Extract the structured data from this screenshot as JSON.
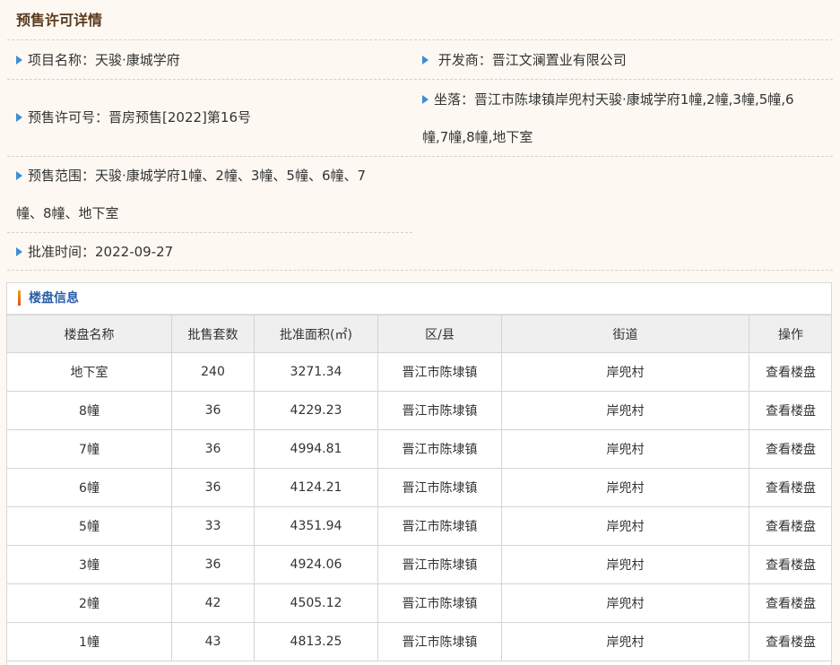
{
  "title": "预售许可详情",
  "info": {
    "project_name": {
      "label": "项目名称：",
      "value": "天骏·康城学府"
    },
    "developer": {
      "label": "开发商：",
      "value": "晋江文澜置业有限公司"
    },
    "permit_no": {
      "label": "预售许可号：",
      "value": "晋房预售[2022]第16号"
    },
    "location": {
      "label": "坐落：",
      "value_line1": "晋江市陈埭镇岸兜村天骏·康城学府1幢,2幢,3幢,5幢,6",
      "value_line2": "幢,7幢,8幢,地下室"
    },
    "scope": {
      "label": "预售范围：",
      "value_line1": "天骏·康城学府1幢、2幢、3幢、5幢、6幢、7",
      "value_line2": "幢、8幢、地下室"
    },
    "approve_date": {
      "label": "批准时间：",
      "value": "2022-09-27"
    }
  },
  "panel": {
    "title": "楼盘信息",
    "columns": [
      "楼盘名称",
      "批售套数",
      "批准面积(㎡)",
      "区/县",
      "街道",
      "操作"
    ],
    "rows": [
      {
        "name": "地下室",
        "units": "240",
        "area": "3271.34",
        "district": "晋江市陈埭镇",
        "street": "岸兜村",
        "action": "查看楼盘"
      },
      {
        "name": "8幢",
        "units": "36",
        "area": "4229.23",
        "district": "晋江市陈埭镇",
        "street": "岸兜村",
        "action": "查看楼盘"
      },
      {
        "name": "7幢",
        "units": "36",
        "area": "4994.81",
        "district": "晋江市陈埭镇",
        "street": "岸兜村",
        "action": "查看楼盘"
      },
      {
        "name": "6幢",
        "units": "36",
        "area": "4124.21",
        "district": "晋江市陈埭镇",
        "street": "岸兜村",
        "action": "查看楼盘"
      },
      {
        "name": "5幢",
        "units": "33",
        "area": "4351.94",
        "district": "晋江市陈埭镇",
        "street": "岸兜村",
        "action": "查看楼盘"
      },
      {
        "name": "3幢",
        "units": "36",
        "area": "4924.06",
        "district": "晋江市陈埭镇",
        "street": "岸兜村",
        "action": "查看楼盘"
      },
      {
        "name": "2幢",
        "units": "42",
        "area": "4505.12",
        "district": "晋江市陈埭镇",
        "street": "岸兜村",
        "action": "查看楼盘"
      },
      {
        "name": "1幢",
        "units": "43",
        "area": "4813.25",
        "district": "晋江市陈埭镇",
        "street": "岸兜村",
        "action": "查看楼盘"
      }
    ]
  },
  "colors": {
    "accent": "#3a8fd6",
    "title": "#5a3a1e",
    "panel_title": "#2a5ea8"
  }
}
